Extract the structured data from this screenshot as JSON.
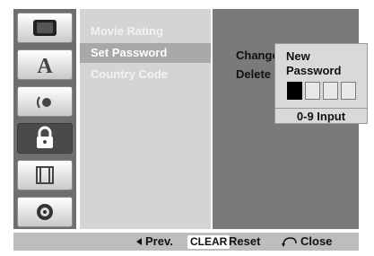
{
  "icons": [
    "disc-settings-icon",
    "language-icon",
    "audio-icon",
    "lock-icon",
    "video-icon",
    "others-icon"
  ],
  "menu": {
    "items": [
      {
        "label": "Movie Rating"
      },
      {
        "label": "Set Password"
      },
      {
        "label": "Country Code"
      }
    ]
  },
  "options": {
    "change": "Change",
    "delete": "Delete"
  },
  "popup": {
    "title_line1": "New",
    "title_line2": "Password",
    "pin_filled": 1,
    "pin_total": 4,
    "hint": "0-9 Input"
  },
  "bottom": {
    "prev": "Prev.",
    "clear_key": "CLEAR",
    "reset": "Reset",
    "close": "Close"
  },
  "colors": {
    "panel_dark": "#6e6e6e",
    "panel_light": "#d4d4d4",
    "selected": "#a8a8a8",
    "option_panel": "#7a7a7a",
    "bottom_bar": "#bdbdbd"
  }
}
